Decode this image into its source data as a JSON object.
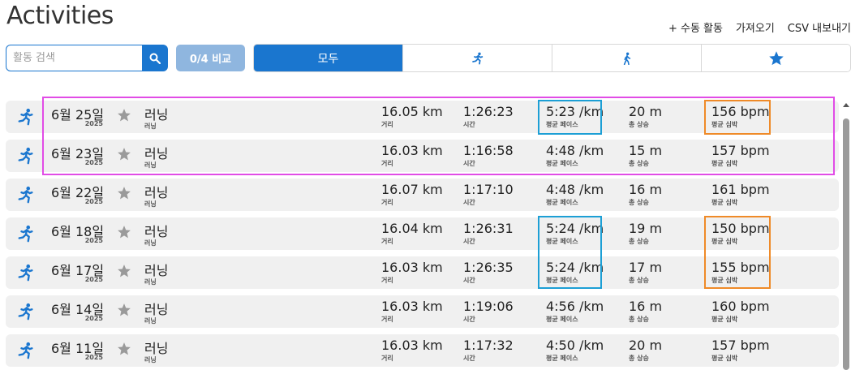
{
  "header": {
    "title": "Activities",
    "actions": [
      "+ 수동 활동",
      "가져오기",
      "CSV 내보내기"
    ]
  },
  "toolbar": {
    "search_placeholder": "활동 검색",
    "compare_label": "0/4 비교",
    "filter_tabs": [
      {
        "label": "모두",
        "icon": "none",
        "active": true
      },
      {
        "label": "",
        "icon": "running-icon",
        "active": false
      },
      {
        "label": "",
        "icon": "walking-icon",
        "active": false
      },
      {
        "label": "",
        "icon": "star-icon",
        "active": false
      }
    ]
  },
  "labels": {
    "distance": "거리",
    "time": "시간",
    "pace": "평균 페이스",
    "elevation": "총 상승",
    "heart_rate": "평균 심박"
  },
  "activities": [
    {
      "date": "6월 25일",
      "year": "2025",
      "name": "러닝",
      "sub": "러닝",
      "distance": "16.05 km",
      "time": "1:26:23",
      "pace": "5:23 /km",
      "elevation": "20 m",
      "heart_rate": "156 bpm"
    },
    {
      "date": "6월 23일",
      "year": "2025",
      "name": "러닝",
      "sub": "러닝",
      "distance": "16.03 km",
      "time": "1:16:58",
      "pace": "4:48 /km",
      "elevation": "15 m",
      "heart_rate": "157 bpm"
    },
    {
      "date": "6월 22일",
      "year": "2025",
      "name": "러닝",
      "sub": "러닝",
      "distance": "16.07 km",
      "time": "1:17:10",
      "pace": "4:48 /km",
      "elevation": "16 m",
      "heart_rate": "161 bpm"
    },
    {
      "date": "6월 18일",
      "year": "2025",
      "name": "러닝",
      "sub": "러닝",
      "distance": "16.04 km",
      "time": "1:26:31",
      "pace": "5:24 /km",
      "elevation": "19 m",
      "heart_rate": "150 bpm"
    },
    {
      "date": "6월 17일",
      "year": "2025",
      "name": "러닝",
      "sub": "러닝",
      "distance": "16.03 km",
      "time": "1:26:35",
      "pace": "5:24 /km",
      "elevation": "17 m",
      "heart_rate": "155 bpm"
    },
    {
      "date": "6월 14일",
      "year": "2025",
      "name": "러닝",
      "sub": "러닝",
      "distance": "16.03 km",
      "time": "1:19:06",
      "pace": "4:56 /km",
      "elevation": "16 m",
      "heart_rate": "160 bpm"
    },
    {
      "date": "6월 11일",
      "year": "2025",
      "name": "러닝",
      "sub": "러닝",
      "distance": "16.03 km",
      "time": "1:17:32",
      "pace": "4:50 /km",
      "elevation": "20 m",
      "heart_rate": "157 bpm"
    }
  ],
  "colors": {
    "accent": "#1a76cf",
    "compare_button": "#8fb6df",
    "highlight_magenta": "#e14ce6",
    "highlight_blue": "#1c9fd5",
    "highlight_orange": "#ef8a28"
  }
}
